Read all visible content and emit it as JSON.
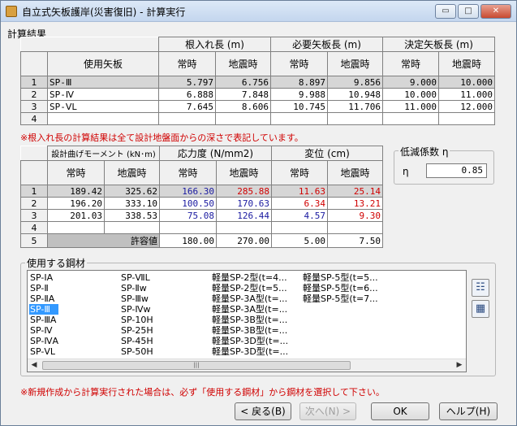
{
  "window": {
    "title": "自立式矢板護岸(災害復旧) - 計算実行",
    "minimize_glyph": "▭",
    "maximize_glyph": "□",
    "close_glyph": "✕"
  },
  "section_label": "計算結果",
  "table1": {
    "group_headers": [
      "根入れ長 (m)",
      "必要矢板長 (m)",
      "決定矢板長 (m)"
    ],
    "col_headers": [
      "使用矢板",
      "常時",
      "地震時",
      "常時",
      "地震時",
      "常時",
      "地震時"
    ],
    "rows": [
      {
        "idx": "1",
        "name": "SP-Ⅲ",
        "v1": "5.797",
        "v2": "6.756",
        "v3": "8.897",
        "v4": "9.856",
        "v5": "9.000",
        "v6": "10.000"
      },
      {
        "idx": "2",
        "name": "SP-Ⅳ",
        "v1": "6.888",
        "v2": "7.848",
        "v3": "9.988",
        "v4": "10.948",
        "v5": "10.000",
        "v6": "11.000"
      },
      {
        "idx": "3",
        "name": "SP-ⅤL",
        "v1": "7.645",
        "v2": "8.606",
        "v3": "10.745",
        "v4": "11.706",
        "v5": "11.000",
        "v6": "12.000"
      },
      {
        "idx": "4",
        "name": "",
        "v1": "",
        "v2": "",
        "v3": "",
        "v4": "",
        "v5": "",
        "v6": ""
      }
    ]
  },
  "note1": "※根入れ長の計算結果は全て設計地盤面からの深さで表記しています。",
  "table2": {
    "group_headers": [
      "設計曲げモーメント (kN･m)",
      "応力度 (N/mm2)",
      "変位 (cm)"
    ],
    "col_headers": [
      "常時",
      "地震時",
      "常時",
      "地震時",
      "常時",
      "地震時"
    ],
    "rows": [
      {
        "idx": "1",
        "m1": "189.42",
        "m2": "325.62",
        "s1": "166.30",
        "s2": "285.88",
        "d1": "11.63",
        "d2": "25.14"
      },
      {
        "idx": "2",
        "m1": "196.20",
        "m2": "333.10",
        "s1": "100.50",
        "s2": "170.63",
        "d1": "6.34",
        "d2": "13.21"
      },
      {
        "idx": "3",
        "m1": "201.03",
        "m2": "338.53",
        "s1": "75.08",
        "s2": "126.44",
        "d1": "4.57",
        "d2": "9.30"
      },
      {
        "idx": "4",
        "m1": "",
        "m2": "",
        "s1": "",
        "s2": "",
        "d1": "",
        "d2": ""
      }
    ],
    "allow_row": {
      "idx": "5",
      "label": "許容値",
      "s1": "180.00",
      "s2": "270.00",
      "d1": "5.00",
      "d2": "7.50"
    },
    "colors": {
      "stress": "#1a1aa0",
      "displacement": "#d00000"
    }
  },
  "reduction": {
    "group_title": "低減係数 η",
    "label": "η",
    "value": "0.85"
  },
  "steel": {
    "group_title": "使用する鋼材",
    "col1": [
      "SP-ⅠA",
      "SP-Ⅱ",
      "SP-ⅡA",
      "SP-Ⅲ",
      "SP-ⅢA",
      "SP-Ⅳ",
      "SP-ⅣA",
      "SP-ⅤL"
    ],
    "col2": [
      "SP-ⅦL",
      "SP-Ⅱw",
      "SP-Ⅲw",
      "SP-Ⅳw",
      "SP-10H",
      "SP-25H",
      "SP-45H",
      "SP-50H"
    ],
    "col3": [
      "軽量SP-2型(t=4...",
      "軽量SP-2型(t=5...",
      "軽量SP-3A型(t=...",
      "軽量SP-3A型(t=...",
      "軽量SP-3B型(t=...",
      "軽量SP-3B型(t=...",
      "軽量SP-3D型(t=...",
      "軽量SP-3D型(t=..."
    ],
    "col4": [
      "軽量SP-5型(t=5...",
      "軽量SP-5型(t=6...",
      "軽量SP-5型(t=7...",
      "",
      "",
      "",
      "",
      ""
    ],
    "selected_index": 3,
    "scroll_left": "◀",
    "scroll_right": "▶",
    "scroll_thumb": "|||"
  },
  "note2": "※新規作成から計算実行された場合は、必ず「使用する鋼材」から鋼材を選択して下さい。",
  "buttons": {
    "back": "< 戻る(B)",
    "next": "次へ(N) >",
    "ok": "OK",
    "help": "ヘルプ(H)"
  },
  "icons": {
    "list_view": "☷",
    "detail_view": "▦"
  }
}
